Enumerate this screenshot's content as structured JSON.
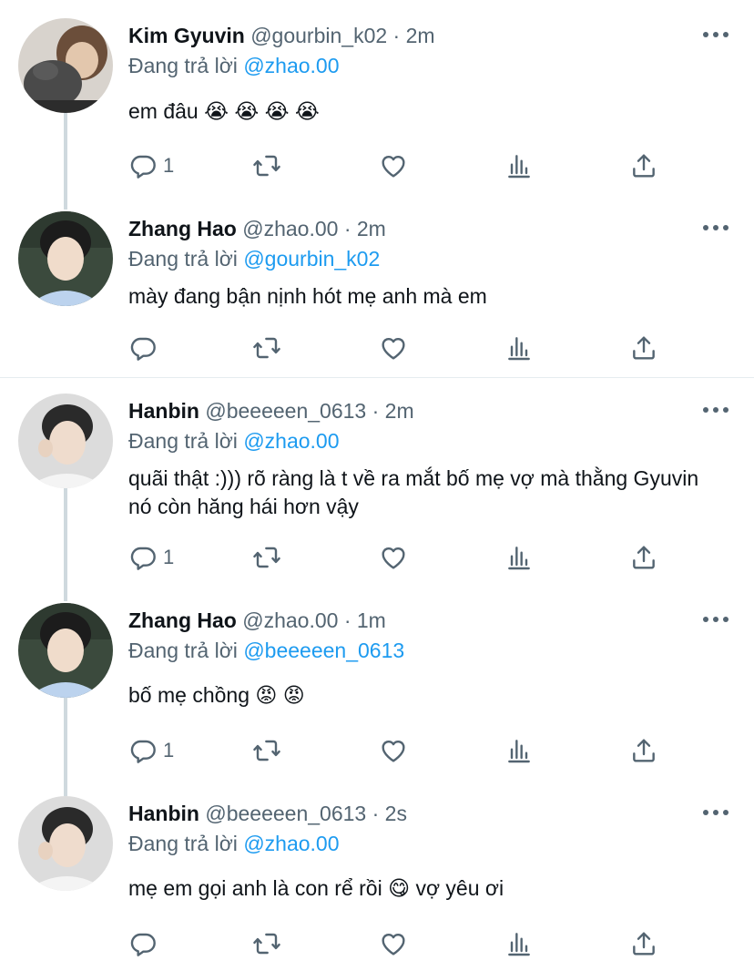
{
  "colors": {
    "link": "#1d9bf0",
    "secondary": "#536471",
    "icon": "#536471"
  },
  "tweets": [
    {
      "name": "Kim Gyuvin",
      "handle": "@gourbin_k02",
      "dot": "·",
      "time": "2m",
      "reply_prefix": "Đang trả lời",
      "reply_to": "@zhao.00",
      "text": "em đâu 😭 😭 😭 😭",
      "reply_count": "1",
      "retweet_count": "",
      "like_count": ""
    },
    {
      "name": "Zhang Hao",
      "handle": "@zhao.00",
      "dot": "·",
      "time": "2m",
      "reply_prefix": "Đang trả lời",
      "reply_to": "@gourbin_k02",
      "text": "mày đang bận nịnh hót mẹ anh mà em",
      "reply_count": "",
      "retweet_count": "",
      "like_count": ""
    },
    {
      "name": "Hanbin",
      "handle": "@beeeeen_0613",
      "dot": "·",
      "time": "2m",
      "reply_prefix": "Đang trả lời",
      "reply_to": "@zhao.00",
      "text": "quãi thật :))) rõ ràng là t về ra mắt bố mẹ vợ mà thằng Gyuvin nó còn hăng hái hơn vậy",
      "reply_count": "1",
      "retweet_count": "",
      "like_count": ""
    },
    {
      "name": "Zhang Hao",
      "handle": "@zhao.00",
      "dot": "·",
      "time": "1m",
      "reply_prefix": "Đang trả lời",
      "reply_to": "@beeeeen_0613",
      "text": "bố mẹ chồng 😡 😡",
      "reply_count": "1",
      "retweet_count": "",
      "like_count": ""
    },
    {
      "name": "Hanbin",
      "handle": "@beeeeen_0613",
      "dot": "·",
      "time": "2s",
      "reply_prefix": "Đang trả lời",
      "reply_to": "@zhao.00",
      "text": "mẹ em gọi anh là con rể rồi 😋  vợ yêu ơi",
      "reply_count": "",
      "retweet_count": "",
      "like_count": ""
    }
  ]
}
